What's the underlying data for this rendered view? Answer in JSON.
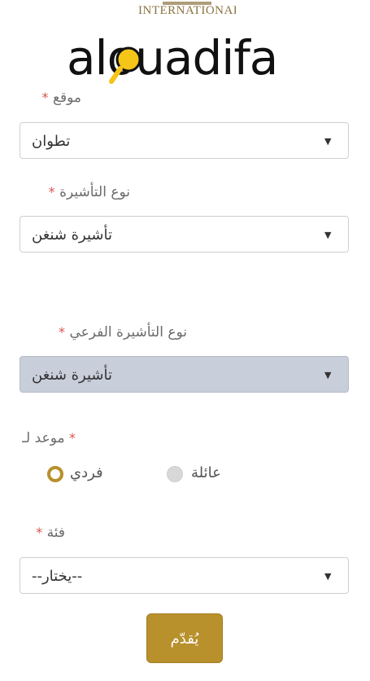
{
  "header": {
    "brand_top_text": "INTERNATIONAL",
    "watermark": "alouadifa"
  },
  "form": {
    "location": {
      "label": "موقع",
      "required_mark": "*",
      "value": "تطوان"
    },
    "visa_type": {
      "label": "نوع التأشيرة",
      "required_mark": "*",
      "value": "تأشيرة شنغن"
    },
    "visa_subtype": {
      "label": "نوع التأشيرة الفرعي",
      "required_mark": "*",
      "value": "تأشيرة شنغن"
    },
    "appointment_for": {
      "label": "موعد لـ",
      "required_mark": "*",
      "options": [
        {
          "label": "فردي",
          "selected": true
        },
        {
          "label": "عائلة",
          "selected": false
        }
      ]
    },
    "category": {
      "label": "فئة",
      "required_mark": "*",
      "value": "--يختار--"
    },
    "submit_label": "يُقدّم"
  },
  "colors": {
    "accent": "#b8902c",
    "required": "#d9534f",
    "disabled_select_bg": "#c9cedb"
  },
  "icons": {
    "select_arrow": "triangle-down-icon",
    "watermark_magnifier": "magnifier-icon"
  }
}
